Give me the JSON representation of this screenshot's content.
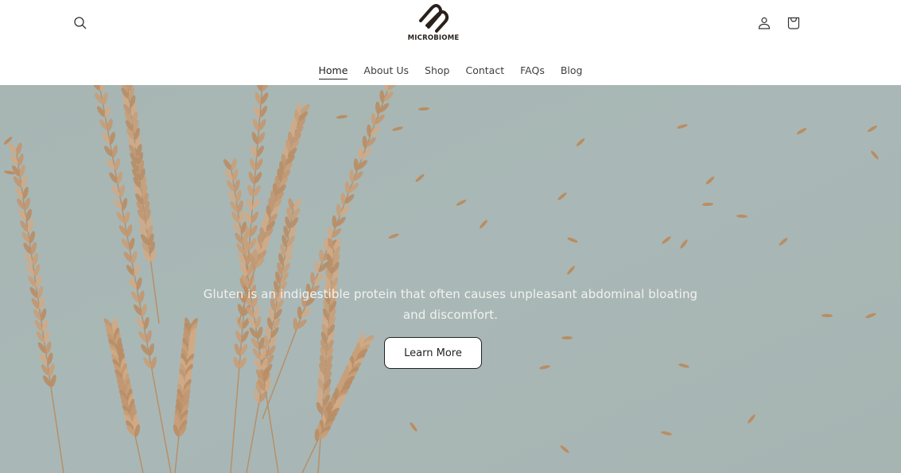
{
  "header": {
    "logo_text": "MICROBIOME",
    "icons": {
      "search": "search-icon",
      "account": "account-icon",
      "cart": "cart-icon"
    }
  },
  "nav": {
    "items": [
      {
        "label": "Home",
        "active": true
      },
      {
        "label": "About Us",
        "active": false
      },
      {
        "label": "Shop",
        "active": false
      },
      {
        "label": "Contact",
        "active": false
      },
      {
        "label": "FAQs",
        "active": false
      },
      {
        "label": "Blog",
        "active": false
      }
    ]
  },
  "hero": {
    "text": "Gluten is an indigestible protein that often causes unpleasant abdominal bloating and discomfort.",
    "button_label": "Learn More",
    "image_description": "dried wheat grass stalks on teal-gray background"
  },
  "colors": {
    "hero_bg": "#a9b5b3",
    "grass": "#c49a72",
    "text_dark": "#222222",
    "hero_text": "#f2f2f0"
  }
}
